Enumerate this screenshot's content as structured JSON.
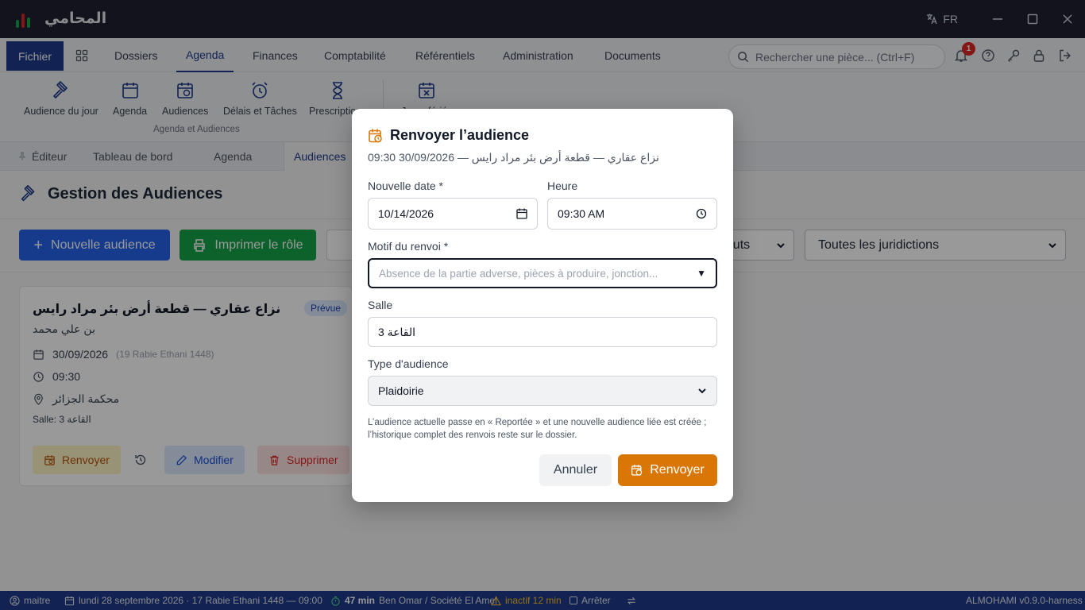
{
  "app": {
    "title": "المحامي",
    "lang": "FR"
  },
  "menu": {
    "file": "Fichier",
    "items": [
      "Dossiers",
      "Agenda",
      "Finances",
      "Comptabilité",
      "Référentiels",
      "Administration",
      "Documents"
    ],
    "active": "Agenda",
    "search_placeholder": "Rechercher une pièce... (Ctrl+F)",
    "notif_count": "1"
  },
  "ribbon": {
    "buttons": [
      "Audience du jour",
      "Agenda",
      "Audiences",
      "Délais et Tâches",
      "Prescriptions",
      "Jours fériés"
    ],
    "group_label": "Agenda et Audiences"
  },
  "tabs": {
    "items": [
      "Éditeur",
      "Tableau de bord",
      "Agenda",
      "Audiences"
    ],
    "active": "Audiences"
  },
  "page": {
    "title": "Gestion des Audiences",
    "new_label": "Nouvelle audience",
    "print_label": "Imprimer le rôle",
    "status_filter": "statuts",
    "jurisdiction_filter": "Toutes les juridictions"
  },
  "card": {
    "title": "نزاع عقاري — قطعة أرض بئر مراد رايس",
    "badge": "Prévue",
    "client": "بن علي محمد",
    "date": "30/09/2026",
    "hijri": "(19 Rabie Ethani 1448)",
    "time": "09:30",
    "court": "محكمة الجزائر",
    "salle": "Salle: القاعة 3",
    "btn_renvoyer": "Renvoyer",
    "btn_modifier": "Modifier",
    "btn_supprimer": "Supprimer"
  },
  "modal": {
    "title": "Renvoyer l’audience",
    "subtitle": "نزاع عقاري — قطعة أرض بئر مراد رايس — 30/09/2026 09:30",
    "date_label": "Nouvelle date *",
    "date_value": "10/14/2026",
    "time_label": "Heure",
    "time_value": "09:30 AM",
    "motif_label": "Motif du renvoi *",
    "motif_placeholder": "Absence de la partie adverse, pièces à produire, jonction...",
    "salle_label": "Salle",
    "salle_value": "القاعة 3",
    "type_label": "Type d'audience",
    "type_value": "Plaidoirie",
    "note": "L’audience actuelle passe en « Reportée » et une nouvelle audience liée est créée ; l’historique complet des renvois reste sur le dossier.",
    "cancel": "Annuler",
    "confirm": "Renvoyer",
    "accent": "#d97706"
  },
  "status": {
    "user": "maitre",
    "date": "lundi 28 septembre 2026 · 17 Rabie Ethani 1448 — 09:00",
    "timer": "47 min",
    "client": "Ben Omar / Société El Amel",
    "inactive": "inactif 12 min",
    "stop": "Arrêter",
    "version": "ALMOHAMI v0.9.0-harness"
  }
}
